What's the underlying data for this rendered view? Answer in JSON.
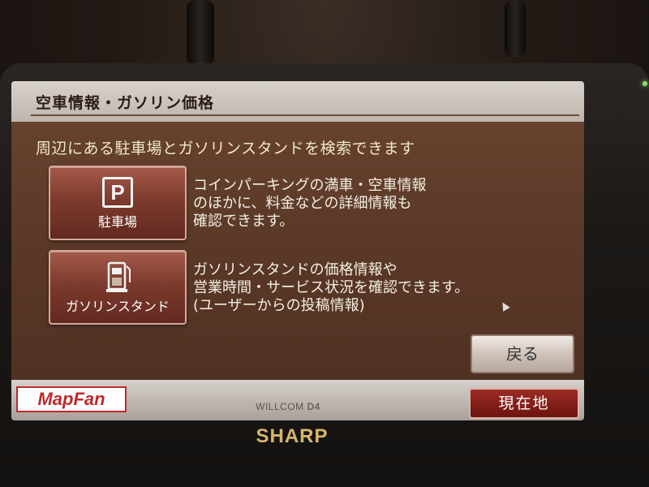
{
  "screen": {
    "title": "空車情報・ガソリン価格",
    "subtitle": "周辺にある駐車場とガソリンスタンドを検索できます"
  },
  "menu": {
    "parking": {
      "label": "駐車場",
      "icon": "parking-icon",
      "icon_glyph": "P",
      "description": "コインパーキングの満車・空車情報\nのほかに、料金などの詳細情報も\n確認できます。"
    },
    "gas": {
      "label": "ガソリンスタンド",
      "icon": "gas-pump-icon",
      "description": "ガソリンスタンドの価格情報や\n営業時間・サービス状況を確認できます。\n(ユーザーからの投稿情報)"
    }
  },
  "buttons": {
    "back": "戻る",
    "current_location": "現在地"
  },
  "branding": {
    "app_logo": "MapFan",
    "model": "WILLCOM",
    "model_suffix": "D4",
    "maker": "SHARP"
  },
  "colors": {
    "screen_bg": "#5a3827",
    "button_red": "#7d3b2e",
    "text_cream": "#f1e7c9"
  }
}
